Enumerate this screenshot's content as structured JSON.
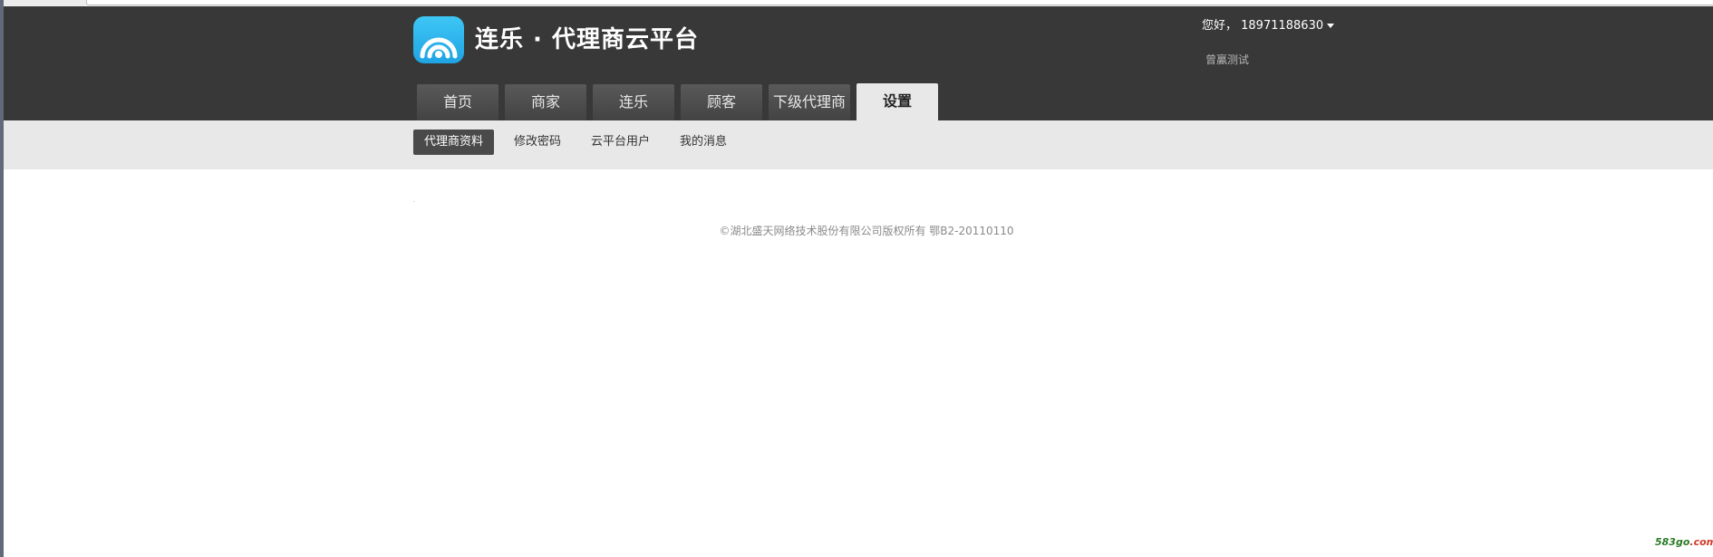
{
  "header": {
    "logo_title": "连乐 · 代理商云平台",
    "greeting": "您好， 18971188630",
    "store_name": "曾鸁测试"
  },
  "tabs": [
    {
      "label": "首页",
      "active": false
    },
    {
      "label": "商家",
      "active": false
    },
    {
      "label": "连乐",
      "active": false
    },
    {
      "label": "顾客",
      "active": false
    },
    {
      "label": "下级代理商",
      "active": false
    },
    {
      "label": "设置",
      "active": true
    }
  ],
  "subnav": [
    {
      "label": "代理商资料",
      "active": true
    },
    {
      "label": "修改密码",
      "active": false
    },
    {
      "label": "云平台用户",
      "active": false
    },
    {
      "label": "我的消息",
      "active": false
    }
  ],
  "footer": {
    "copyright": "©湖北盛天网络技术股份有限公司版权所有 鄂B2-20110110"
  },
  "watermark": {
    "main": "583go",
    "suffix": ".com"
  },
  "colors": {
    "header_bg": "#383838",
    "subnav_bg": "#e8e8e8",
    "logo_blue": "#29b4ee"
  }
}
